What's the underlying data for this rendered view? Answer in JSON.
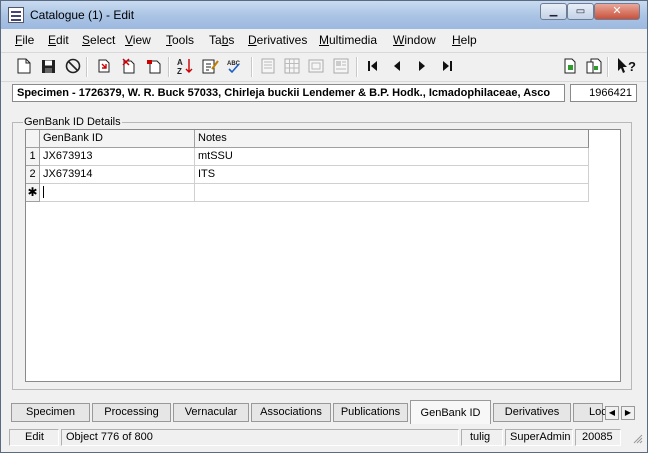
{
  "window": {
    "title": "Catalogue (1) - Edit",
    "min_glyph": "▁",
    "max_glyph": "▭",
    "close_glyph": "✕"
  },
  "menu": [
    {
      "label": "File",
      "underline": "F"
    },
    {
      "label": "Edit",
      "underline": "E"
    },
    {
      "label": "Select",
      "underline": "S"
    },
    {
      "label": "View",
      "underline": "V"
    },
    {
      "label": "Tools",
      "underline": "T"
    },
    {
      "label": "Tabs",
      "underline": "b"
    },
    {
      "label": "Derivatives",
      "underline": "D"
    },
    {
      "label": "Multimedia",
      "underline": "M"
    },
    {
      "label": "Window",
      "underline": "W"
    },
    {
      "label": "Help",
      "underline": "H"
    }
  ],
  "toolbar": {
    "icons": [
      "new-record-icon",
      "save-icon",
      "cancel-icon",
      "insert-icon",
      "delete-record-icon",
      "bookmark-icon",
      "sort-icon",
      "edit-note-icon",
      "spell-check-icon",
      "page-view-icon",
      "grid-view-icon",
      "list-view-icon",
      "image-view-icon",
      "first-record-icon",
      "previous-record-icon",
      "next-record-icon",
      "last-record-icon",
      "attach-icon",
      "copy-icon",
      "context-help-icon"
    ],
    "spell_label": "ABC",
    "help_label": "?"
  },
  "record": {
    "summary": "Specimen - 1726379, W. R. Buck 57033, Chirleja buckii Lendemer & B.P. Hodk., Icmadophilaceae, Asco",
    "irn": "1966421"
  },
  "group": {
    "title": "GenBank ID Details"
  },
  "grid": {
    "columns": [
      "GenBank ID",
      "Notes"
    ],
    "rows": [
      {
        "index": "1",
        "genbank_id": "JX673913",
        "notes": "mtSSU"
      },
      {
        "index": "2",
        "genbank_id": "JX673914",
        "notes": "ITS"
      }
    ],
    "new_row_marker": "✱"
  },
  "tabs": {
    "items": [
      "Specimen",
      "Processing",
      "Vernacular",
      "Associations",
      "Publications",
      "GenBank ID",
      "Derivatives",
      "Loc"
    ],
    "active": "GenBank ID",
    "scroll_left": "◀",
    "scroll_right": "▶"
  },
  "status": {
    "mode": "Edit",
    "position": "Object 776 of 800",
    "user": "tulig",
    "group": "SuperAdmin",
    "count": "20085"
  }
}
